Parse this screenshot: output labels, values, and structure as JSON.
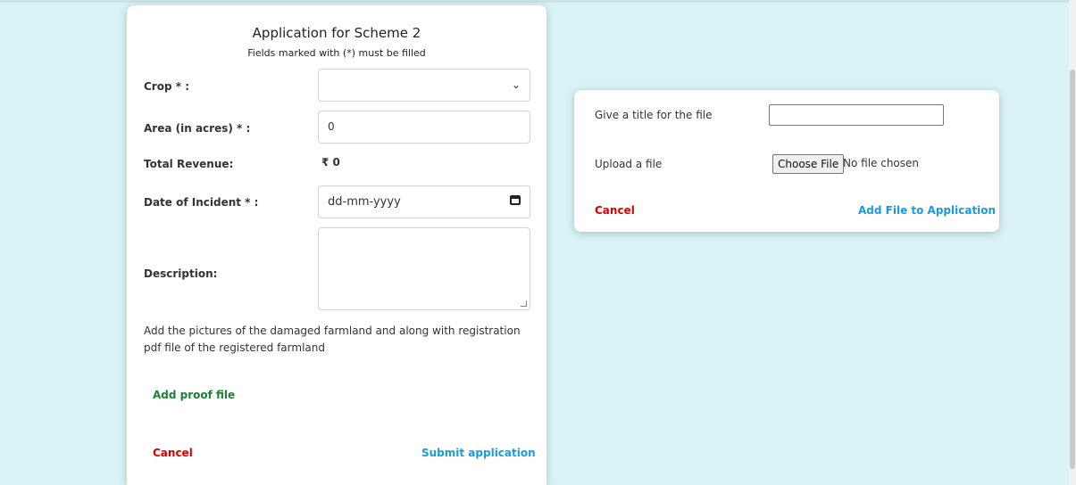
{
  "application_form": {
    "title": "Application for Scheme 2",
    "subtitle": "Fields marked with (*) must be filled",
    "crop_label": "Crop * :",
    "crop_value": "",
    "area_label": "Area (in acres) * :",
    "area_value": "0",
    "revenue_label": "Total Revenue:",
    "revenue_value": "₹ 0",
    "date_label": "Date of Incident * :",
    "date_placeholder": "dd-mm-yyyy",
    "description_label": "Description:",
    "description_value": "",
    "proof_info": "Add the pictures of the damaged farmland and along with registration pdf file of the registered farmland",
    "add_proof_label": "Add proof file",
    "cancel_label": "Cancel",
    "submit_label": "Submit application"
  },
  "file_dialog": {
    "title_label": "Give a title for the file",
    "title_value": "",
    "upload_label": "Upload a file",
    "choose_file_label": "Choose File",
    "no_file_text": "No file chosen",
    "cancel_label": "Cancel",
    "add_file_label": "Add File to Application"
  },
  "colors": {
    "background": "#d8f4f7",
    "cancel": "#dc0000",
    "primary_link": "#1a9bdf",
    "add_proof": "#1e7e34"
  }
}
